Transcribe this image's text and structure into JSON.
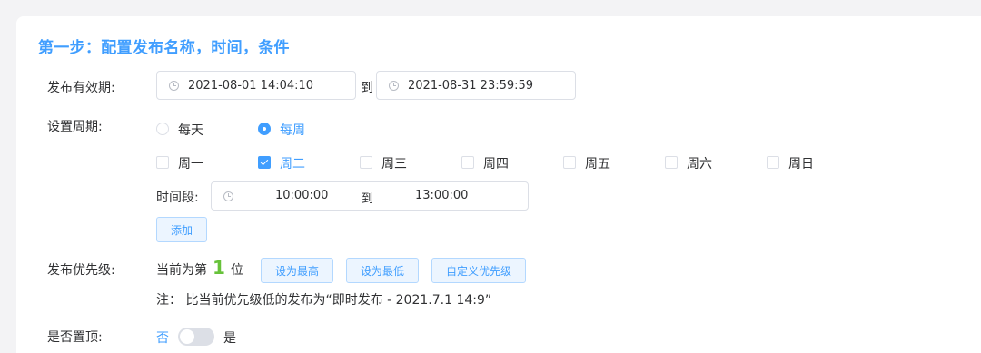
{
  "step": {
    "title": "第一步：配置发布名称，时间，条件"
  },
  "validity": {
    "label": "发布有效期:",
    "start": "2021-08-01 14:04:10",
    "to": "到",
    "end": "2021-08-31 23:59:59"
  },
  "period": {
    "label": "设置周期:",
    "options": [
      {
        "label": "每天",
        "checked": false
      },
      {
        "label": "每周",
        "checked": true
      }
    ],
    "days": [
      {
        "label": "周一",
        "checked": false
      },
      {
        "label": "周二",
        "checked": true
      },
      {
        "label": "周三",
        "checked": false
      },
      {
        "label": "周四",
        "checked": false
      },
      {
        "label": "周五",
        "checked": false
      },
      {
        "label": "周六",
        "checked": false
      },
      {
        "label": "周日",
        "checked": false
      }
    ],
    "time_range_label": "时间段:",
    "time_start": "10:00:00",
    "time_to": "到",
    "time_end": "13:00:00",
    "add_label": "添加"
  },
  "priority": {
    "label": "发布优先级:",
    "prefix": "当前为第",
    "rank": "1",
    "suffix": "位",
    "set_highest": "设为最高",
    "set_lowest": "设为最低",
    "custom": "自定义优先级",
    "note": "注：  比当前优先级低的发布为“即时发布 - 2021.7.1 14:9”"
  },
  "pin": {
    "label": "是否置顶:",
    "off_label": "否",
    "on_label": "是",
    "enabled": false
  },
  "colors": {
    "accent": "#409eff",
    "rank": "#67c23a"
  }
}
